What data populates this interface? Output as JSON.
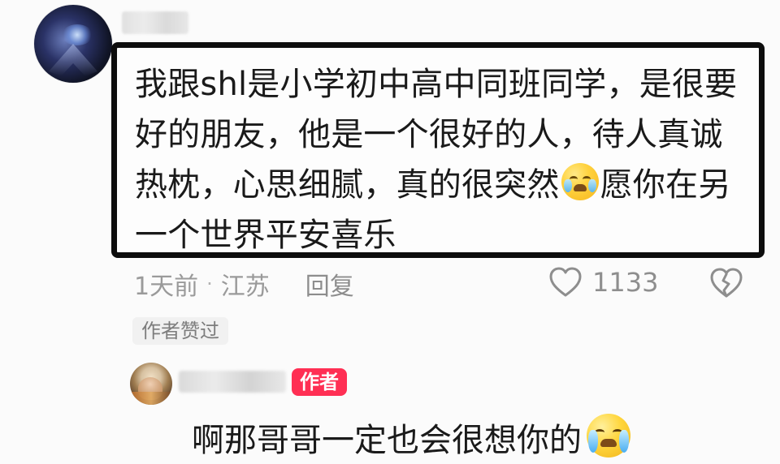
{
  "comment": {
    "text_part_1": "我跟shl是小学初中高中同班同学，是很要好的朋友，他是一个很好的人，待人真诚热枕，心思细腻，真的很突然",
    "text_part_2": "愿你在另一个世界平安喜乐",
    "emoji": "crying-face-emoji",
    "time": "1天前",
    "location": "江苏",
    "reply_label": "回复",
    "like_count": "1133",
    "author_liked_badge": "作者赞过"
  },
  "reply": {
    "author_badge": "作者",
    "text": "啊那哥哥一定也会很想你的",
    "emoji": "loudly-crying-face-emoji"
  },
  "icons": {
    "like": "heart-icon",
    "dislike": "broken-heart-icon"
  },
  "colors": {
    "author_badge": "#ff2f54",
    "highlight_border": "#0d0d0d",
    "meta_text": "#9a9a9a"
  }
}
